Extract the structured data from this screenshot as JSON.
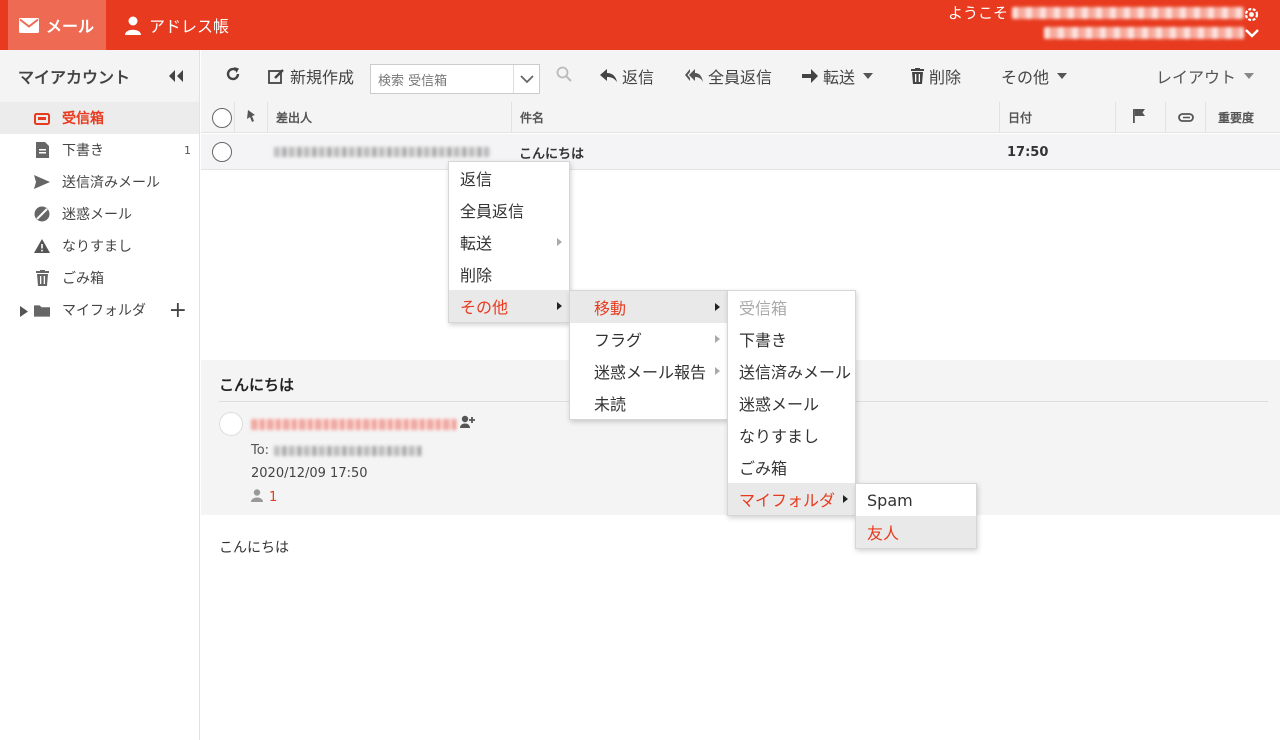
{
  "topbar": {
    "mail_tab": "メール",
    "address_tab": "アドレス帳",
    "welcome": "ようこそ",
    "accent_color": "#e83a1e"
  },
  "sidebar": {
    "title": "マイアカウント",
    "items": [
      {
        "label": "受信箱",
        "icon": "inbox-icon",
        "count": ""
      },
      {
        "label": "下書き",
        "icon": "draft-icon",
        "count": "1"
      },
      {
        "label": "送信済みメール",
        "icon": "sent-icon",
        "count": ""
      },
      {
        "label": "迷惑メール",
        "icon": "spam-icon",
        "count": ""
      },
      {
        "label": "なりすまし",
        "icon": "warning-icon",
        "count": ""
      },
      {
        "label": "ごみ箱",
        "icon": "trash-icon",
        "count": ""
      },
      {
        "label": "マイフォルダ",
        "icon": "folder-icon",
        "count": ""
      }
    ],
    "add_symbol": "+"
  },
  "toolbar": {
    "compose": "新規作成",
    "search_placeholder": "検索 受信箱",
    "reply": "返信",
    "reply_all": "全員返信",
    "forward": "転送",
    "delete": "削除",
    "more": "その他",
    "layout": "レイアウト"
  },
  "list": {
    "columns": {
      "from": "差出人",
      "subject": "件名",
      "date": "日付",
      "priority": "重要度"
    },
    "rows": [
      {
        "subject": "こんにちは",
        "date": "17:50"
      }
    ]
  },
  "preview": {
    "subject": "こんにちは",
    "to_label": "To:",
    "date": "2020/12/09 17:50",
    "recipient_count": "1",
    "body": "こんにちは"
  },
  "context_menu": {
    "main": [
      "返信",
      "全員返信",
      "転送",
      "削除",
      "その他"
    ],
    "other": [
      "移動",
      "フラグ",
      "迷惑メール報告",
      "未読"
    ],
    "move": [
      "受信箱",
      "下書き",
      "送信済みメール",
      "迷惑メール",
      "なりすまし",
      "ごみ箱",
      "マイフォルダ"
    ],
    "my_folder": [
      "Spam",
      "友人"
    ]
  }
}
